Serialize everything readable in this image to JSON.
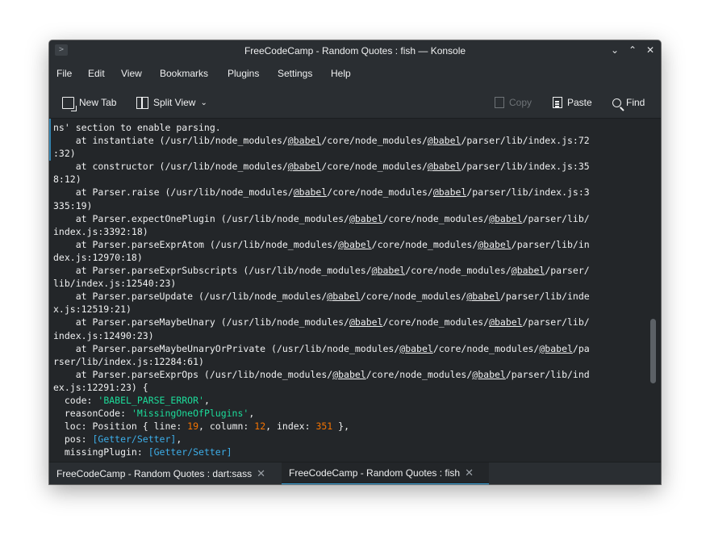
{
  "window": {
    "title": "FreeCodeCamp - Random Quotes : fish — Konsole",
    "app_icon": ">",
    "controls": {
      "minimize": "⌄",
      "maximize": "⌃",
      "close": "✕"
    }
  },
  "menubar": {
    "items": [
      "File",
      "Edit",
      "View",
      "Bookmarks",
      "Plugins",
      "Settings",
      "Help"
    ]
  },
  "toolbar": {
    "new_tab": "New Tab",
    "split_view": "Split View",
    "copy": "Copy",
    "paste": "Paste",
    "find": "Find"
  },
  "terminal": {
    "lines": [
      [
        {
          "t": "ns' section to enable parsing."
        }
      ],
      [
        {
          "t": "    at instantiate (/usr/lib/node_modules/"
        },
        {
          "t": "@babel",
          "c": "u"
        },
        {
          "t": "/core/node_modules/"
        },
        {
          "t": "@babel",
          "c": "u"
        },
        {
          "t": "/parser/lib/index.js:72"
        }
      ],
      [
        {
          "t": ":32)"
        }
      ],
      [
        {
          "t": "    at constructor (/usr/lib/node_modules/"
        },
        {
          "t": "@babel",
          "c": "u"
        },
        {
          "t": "/core/node_modules/"
        },
        {
          "t": "@babel",
          "c": "u"
        },
        {
          "t": "/parser/lib/index.js:35"
        }
      ],
      [
        {
          "t": "8:12)"
        }
      ],
      [
        {
          "t": "    at Parser.raise (/usr/lib/node_modules/"
        },
        {
          "t": "@babel",
          "c": "u"
        },
        {
          "t": "/core/node_modules/"
        },
        {
          "t": "@babel",
          "c": "u"
        },
        {
          "t": "/parser/lib/index.js:3"
        }
      ],
      [
        {
          "t": "335:19)"
        }
      ],
      [
        {
          "t": "    at Parser.expectOnePlugin (/usr/lib/node_modules/"
        },
        {
          "t": "@babel",
          "c": "u"
        },
        {
          "t": "/core/node_modules/"
        },
        {
          "t": "@babel",
          "c": "u"
        },
        {
          "t": "/parser/lib/"
        }
      ],
      [
        {
          "t": "index.js:3392:18)"
        }
      ],
      [
        {
          "t": "    at Parser.parseExprAtom (/usr/lib/node_modules/"
        },
        {
          "t": "@babel",
          "c": "u"
        },
        {
          "t": "/core/node_modules/"
        },
        {
          "t": "@babel",
          "c": "u"
        },
        {
          "t": "/parser/lib/in"
        }
      ],
      [
        {
          "t": "dex.js:12970:18)"
        }
      ],
      [
        {
          "t": "    at Parser.parseExprSubscripts (/usr/lib/node_modules/"
        },
        {
          "t": "@babel",
          "c": "u"
        },
        {
          "t": "/core/node_modules/"
        },
        {
          "t": "@babel",
          "c": "u"
        },
        {
          "t": "/parser/"
        }
      ],
      [
        {
          "t": "lib/index.js:12540:23)"
        }
      ],
      [
        {
          "t": "    at Parser.parseUpdate (/usr/lib/node_modules/"
        },
        {
          "t": "@babel",
          "c": "u"
        },
        {
          "t": "/core/node_modules/"
        },
        {
          "t": "@babel",
          "c": "u"
        },
        {
          "t": "/parser/lib/inde"
        }
      ],
      [
        {
          "t": "x.js:12519:21)"
        }
      ],
      [
        {
          "t": "    at Parser.parseMaybeUnary (/usr/lib/node_modules/"
        },
        {
          "t": "@babel",
          "c": "u"
        },
        {
          "t": "/core/node_modules/"
        },
        {
          "t": "@babel",
          "c": "u"
        },
        {
          "t": "/parser/lib/"
        }
      ],
      [
        {
          "t": "index.js:12490:23)"
        }
      ],
      [
        {
          "t": "    at Parser.parseMaybeUnaryOrPrivate (/usr/lib/node_modules/"
        },
        {
          "t": "@babel",
          "c": "u"
        },
        {
          "t": "/core/node_modules/"
        },
        {
          "t": "@babel",
          "c": "u"
        },
        {
          "t": "/pa"
        }
      ],
      [
        {
          "t": "rser/lib/index.js:12284:61)"
        }
      ],
      [
        {
          "t": "    at Parser.parseExprOps (/usr/lib/node_modules/"
        },
        {
          "t": "@babel",
          "c": "u"
        },
        {
          "t": "/core/node_modules/"
        },
        {
          "t": "@babel",
          "c": "u"
        },
        {
          "t": "/parser/lib/ind"
        }
      ],
      [
        {
          "t": "ex.js:12291:23) {"
        }
      ],
      [
        {
          "t": "  code: "
        },
        {
          "t": "'BABEL_PARSE_ERROR'",
          "c": "str"
        },
        {
          "t": ","
        }
      ],
      [
        {
          "t": "  reasonCode: "
        },
        {
          "t": "'MissingOneOfPlugins'",
          "c": "str"
        },
        {
          "t": ","
        }
      ],
      [
        {
          "t": "  loc: Position { line: "
        },
        {
          "t": "19",
          "c": "num"
        },
        {
          "t": ", column: "
        },
        {
          "t": "12",
          "c": "num"
        },
        {
          "t": ", index: "
        },
        {
          "t": "351",
          "c": "num"
        },
        {
          "t": " },"
        }
      ],
      [
        {
          "t": "  pos: "
        },
        {
          "t": "[Getter/Setter]",
          "c": "cyan"
        },
        {
          "t": ","
        }
      ],
      [
        {
          "t": "  missingPlugin: "
        },
        {
          "t": "[Getter/Setter]",
          "c": "cyan"
        }
      ]
    ]
  },
  "tabs": [
    {
      "label": "FreeCodeCamp - Random Quotes : dart:sass",
      "active": false
    },
    {
      "label": "FreeCodeCamp - Random Quotes : fish",
      "active": true
    }
  ],
  "tab_close_glyph": "✕",
  "colors": {
    "background": "#232629",
    "accent": "#3daee9",
    "string": "#1cdc9a",
    "number": "#f67400"
  }
}
